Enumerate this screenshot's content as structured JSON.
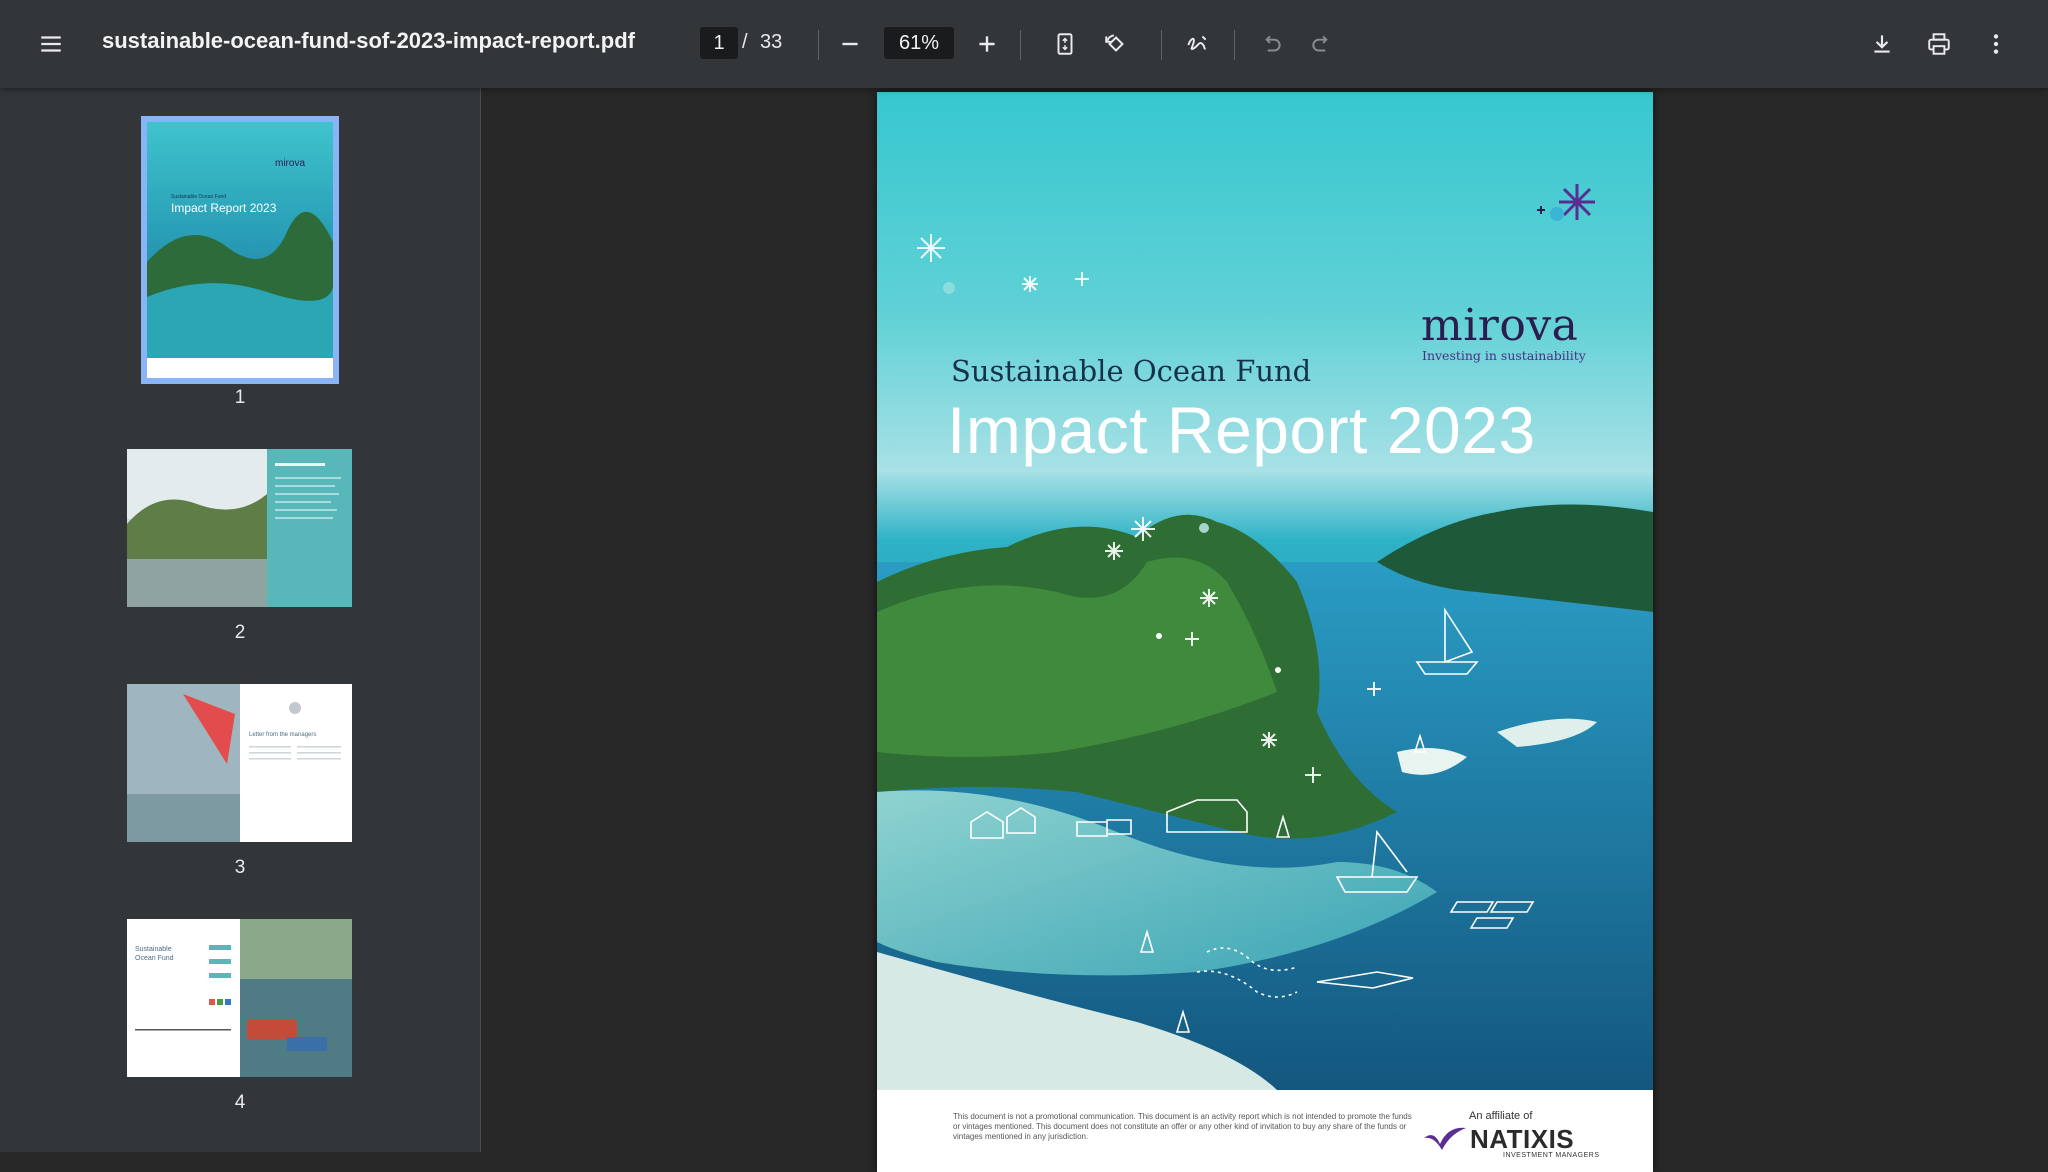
{
  "toolbar": {
    "menu_icon": "hamburger-menu-icon",
    "document_title": "sustainable-ocean-fund-sof-2023-impact-report.pdf",
    "current_page": "1",
    "page_separator": "/",
    "total_pages": "33",
    "zoom": "61%",
    "icons": [
      "minus-icon",
      "plus-icon",
      "fit-page-icon",
      "rotate-icon",
      "annotate-icon",
      "undo-icon",
      "redo-icon",
      "download-icon",
      "print-icon",
      "more-vert-icon"
    ]
  },
  "sidebar": {
    "thumbnails": [
      {
        "number": "1",
        "selected": true
      },
      {
        "number": "2",
        "selected": false
      },
      {
        "number": "3",
        "selected": false
      },
      {
        "number": "4",
        "selected": false
      }
    ]
  },
  "page": {
    "brand": "mirova",
    "brand_tagline": "Investing in sustainability",
    "fund_name": "Sustainable Ocean Fund",
    "report_title": "Impact Report 2023",
    "disclaimer": "This document is not a promotional communication. This document is an activity report which is not intended to promote the funds or vintages mentioned. This document does not constitute an offer or any other kind of invitation to buy any share of the funds or vintages mentioned in any jurisdiction.",
    "affiliate_text": "An affiliate of",
    "affiliate_brand": "NATIXIS",
    "affiliate_sub": "INVESTMENT MANAGERS"
  },
  "colors": {
    "toolbar_bg": "#323639",
    "viewer_bg": "#282828",
    "selection": "#8ab4f8",
    "brand_purple": "#4c2d84"
  }
}
